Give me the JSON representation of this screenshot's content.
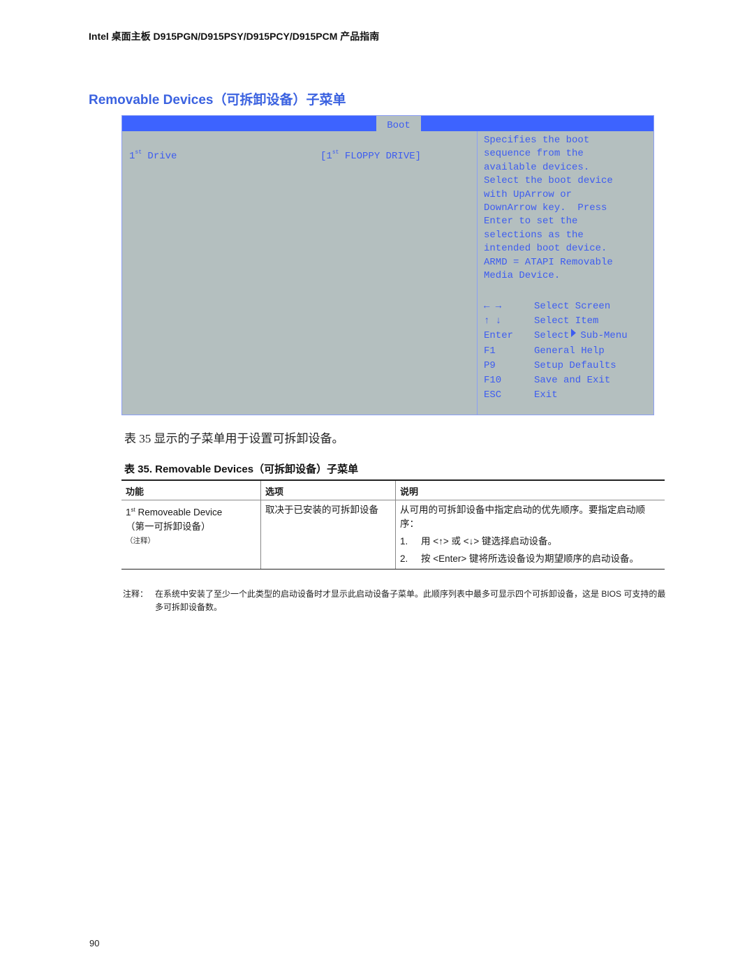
{
  "header": {
    "title": "Intel 桌面主板 D915PGN/D915PSY/D915PCY/D915PCM 产品指南"
  },
  "section_title": "Removable Devices（可拆卸设备）子菜单",
  "bios": {
    "active_tab": "Boot",
    "item": {
      "label_num": "1",
      "label_sup": "st",
      "label_text": " Drive",
      "value_prefix": "[1",
      "value_sup": "st",
      "value_text": " FLOPPY DRIVE]"
    },
    "help_text": "Specifies the boot\nsequence from the\navailable devices.\nSelect the boot device\nwith UpArrow or\nDownArrow key.  Press\nEnter to set the\nselections as the\nintended boot device.\nARMD = ATAPI Removable\nMedia Device.",
    "keys": [
      {
        "key": "← →",
        "action": "Select Screen"
      },
      {
        "key": "↑ ↓",
        "action": "Select Item"
      },
      {
        "key": "Enter",
        "action_pre": "Select",
        "action_post": "Sub-Menu",
        "icon": "triangle-right-icon"
      },
      {
        "key": "F1",
        "action": "General Help"
      },
      {
        "key": "P9",
        "action": "Setup Defaults"
      },
      {
        "key": "F10",
        "action": "Save and Exit"
      },
      {
        "key": "ESC",
        "action": "Exit"
      }
    ]
  },
  "paragraph": "表 35 显示的子菜单用于设置可拆卸设备。",
  "table": {
    "caption": "表 35.   Removable Devices（可拆卸设备）子菜单",
    "headers": [
      "功能",
      "选项",
      "说明"
    ],
    "row": {
      "feature_num": "1",
      "feature_sup": "st",
      "feature_text": " Removeable Device",
      "feature_zh": "（第一可拆卸设备）",
      "feature_note": "（注释）",
      "option": "取决于已安装的可拆卸设备",
      "description": "从可用的可拆卸设备中指定启动的优先顺序。要指定启动顺序：",
      "steps": [
        {
          "num": "1.",
          "text": "用 <↑> 或 <↓> 键选择启动设备。"
        },
        {
          "num": "2.",
          "text": "按 <Enter> 键将所选设备设为期望顺序的启动设备。"
        }
      ]
    }
  },
  "footnote": {
    "label": "注释：",
    "text": "在系统中安装了至少一个此类型的启动设备时才显示此启动设备子菜单。此顺序列表中最多可显示四个可拆卸设备，这是 BIOS 可支持的最多可拆卸设备数。"
  },
  "page_number": "90"
}
